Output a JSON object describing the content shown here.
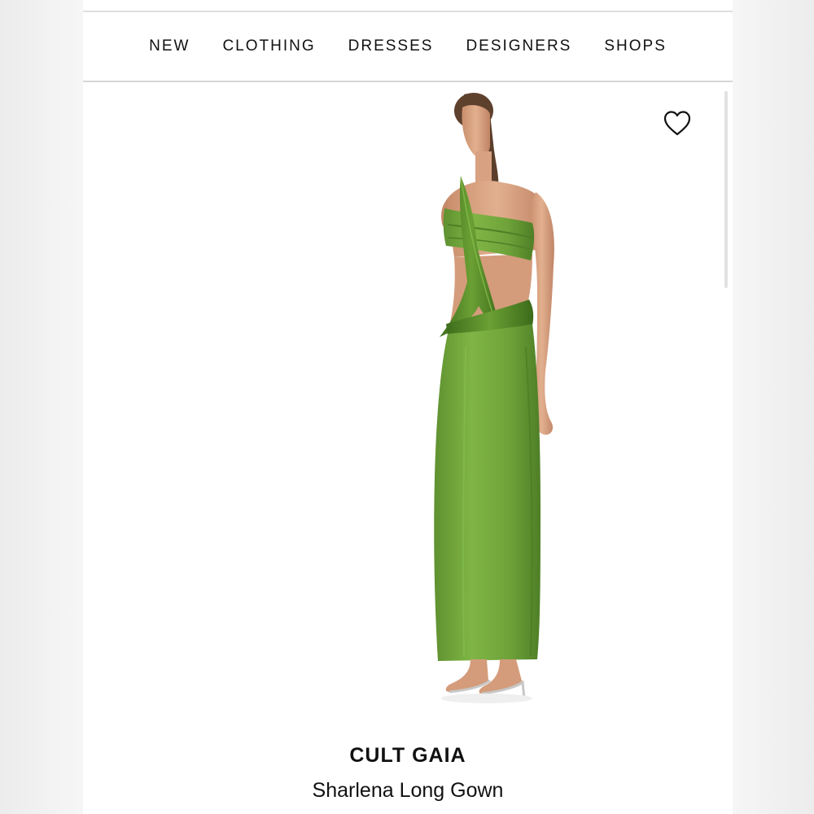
{
  "nav": {
    "items": [
      {
        "label": "NEW"
      },
      {
        "label": "CLOTHING"
      },
      {
        "label": "DRESSES"
      },
      {
        "label": "DESIGNERS"
      },
      {
        "label": "SHOPS"
      }
    ]
  },
  "product": {
    "brand": "CULT GAIA",
    "name": "Sharlena Long Gown",
    "image_icon": "model-in-green-gown-image",
    "gown_color": "#73a63c",
    "wishlist_icon": "heart-outline-icon"
  }
}
